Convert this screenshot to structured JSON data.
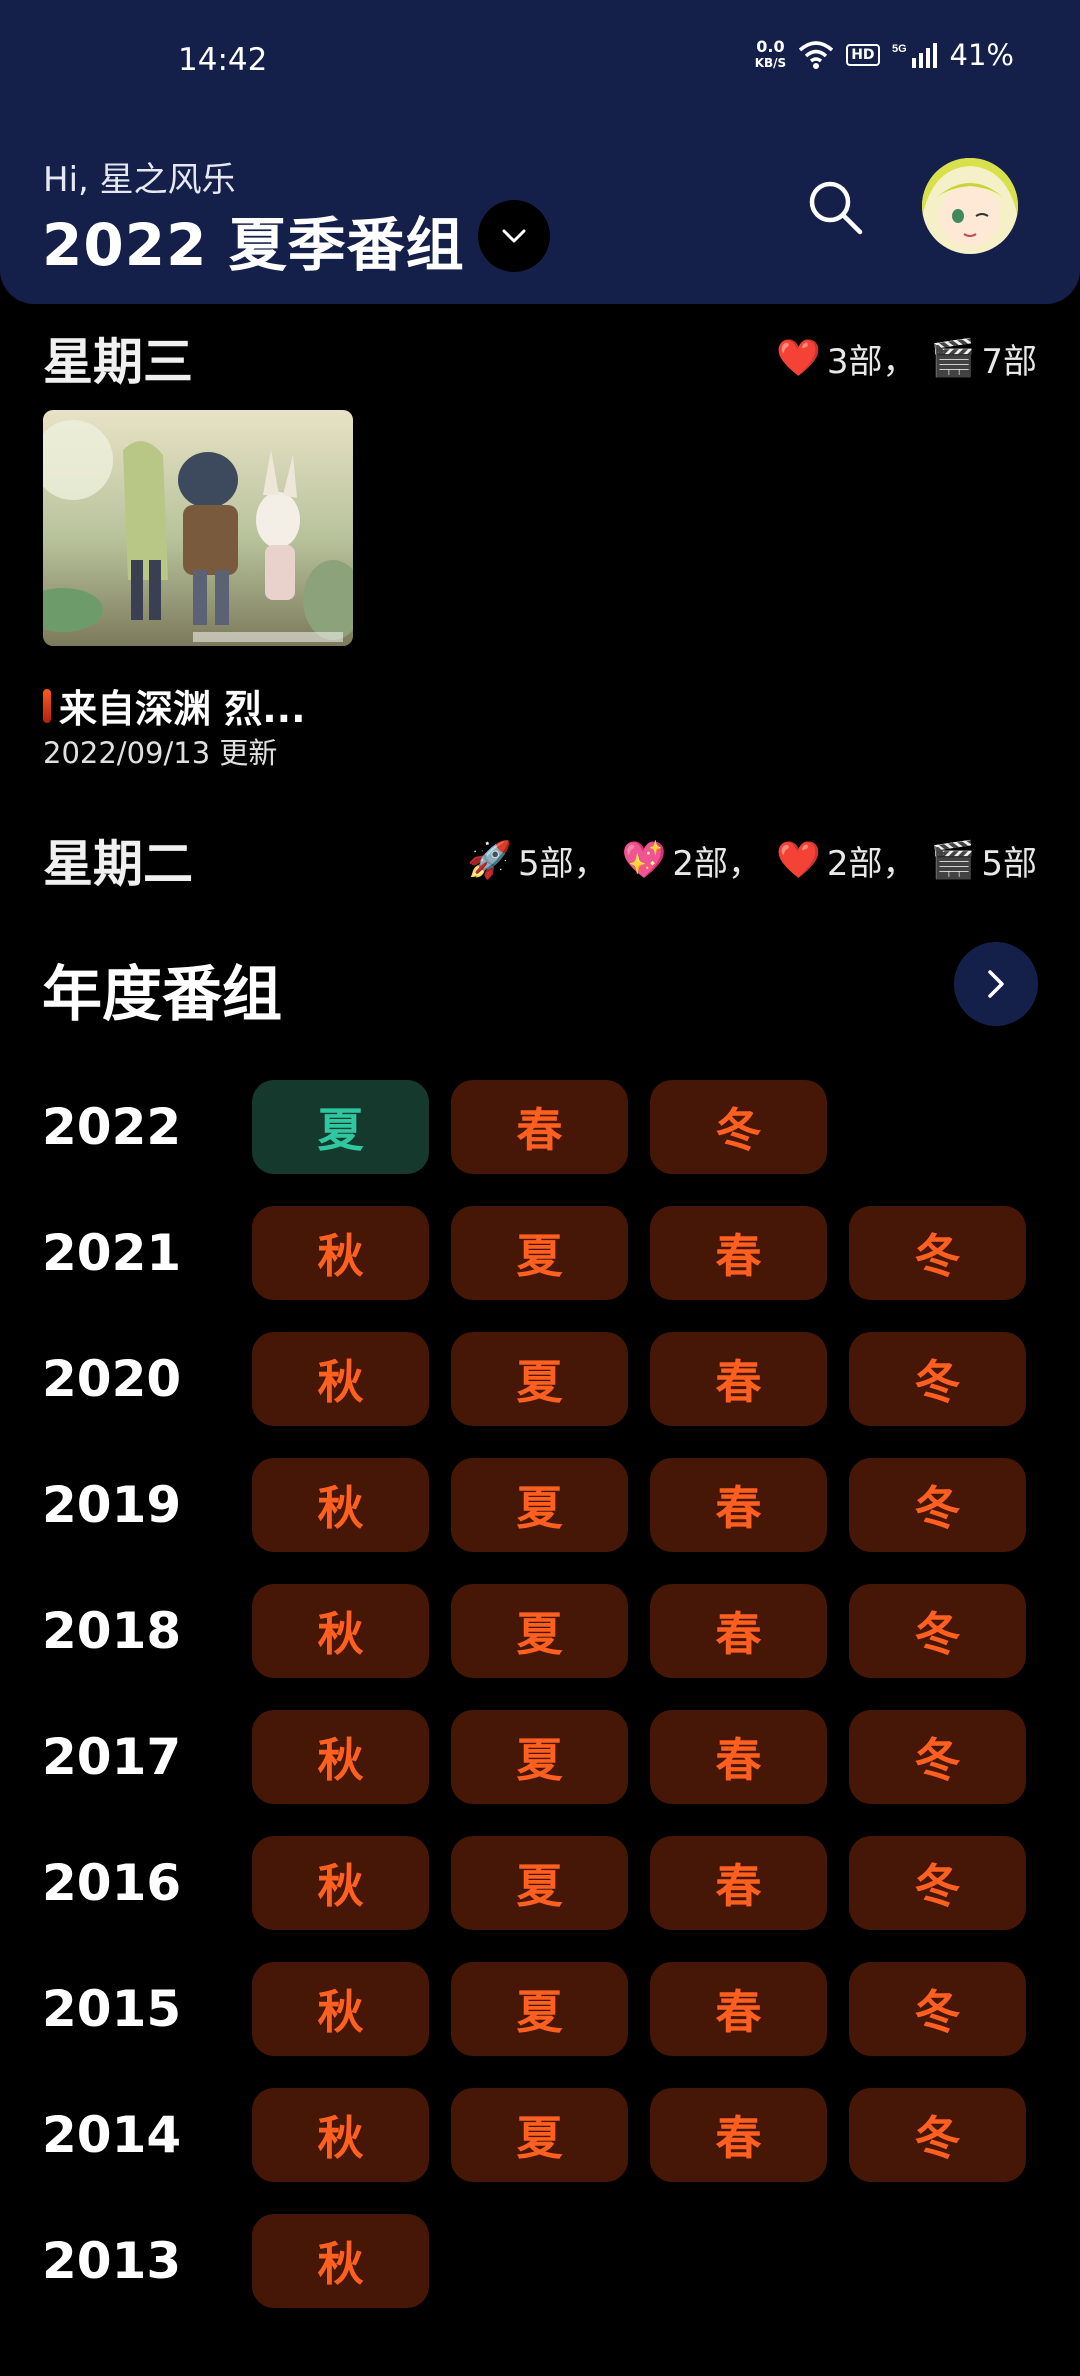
{
  "status_bar": {
    "time": "14:42",
    "net_speed_value": "0.0",
    "net_speed_unit": "KB/S",
    "hd": "HD",
    "signal": "5G",
    "battery": "41%"
  },
  "header": {
    "greeting": "Hi, 星之风乐",
    "title": "2022 夏季番组"
  },
  "schedule": [
    {
      "day": "星期三",
      "stats": [
        {
          "emoji": "❤️",
          "text": "3部，"
        },
        {
          "emoji": "🎬",
          "text": "7部"
        }
      ]
    },
    {
      "day": "星期二",
      "stats": [
        {
          "emoji": "🚀",
          "text": "5部，"
        },
        {
          "emoji": "💖",
          "text": "2部，"
        },
        {
          "emoji": "❤️",
          "text": "2部，"
        },
        {
          "emoji": "🎬",
          "text": "5部"
        }
      ]
    }
  ],
  "card": {
    "title": "来自深渊 烈...",
    "date": "2022/09/13 更新"
  },
  "annual": {
    "title": "年度番组",
    "years": [
      {
        "year": "2022",
        "seasons": [
          "夏",
          "春",
          "冬"
        ]
      },
      {
        "year": "2021",
        "seasons": [
          "秋",
          "夏",
          "春",
          "冬"
        ]
      },
      {
        "year": "2020",
        "seasons": [
          "秋",
          "夏",
          "春",
          "冬"
        ]
      },
      {
        "year": "2019",
        "seasons": [
          "秋",
          "夏",
          "春",
          "冬"
        ]
      },
      {
        "year": "2018",
        "seasons": [
          "秋",
          "夏",
          "春",
          "冬"
        ]
      },
      {
        "year": "2017",
        "seasons": [
          "秋",
          "夏",
          "春",
          "冬"
        ]
      },
      {
        "year": "2016",
        "seasons": [
          "秋",
          "夏",
          "春",
          "冬"
        ]
      },
      {
        "year": "2015",
        "seasons": [
          "秋",
          "夏",
          "春",
          "冬"
        ]
      },
      {
        "year": "2014",
        "seasons": [
          "秋",
          "夏",
          "春",
          "冬"
        ]
      },
      {
        "year": "2013",
        "seasons": [
          "秋"
        ]
      }
    ]
  },
  "colors": {
    "header_bg": "#14204a",
    "season_bg": "#461706",
    "season_text": "#ff5f1f",
    "current_bg": "#15392d",
    "current_text": "#2ec7a0"
  }
}
